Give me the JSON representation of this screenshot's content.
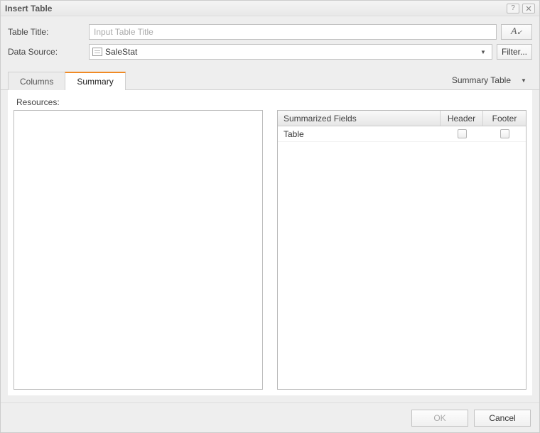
{
  "window": {
    "title": "Insert Table"
  },
  "form": {
    "title_label": "Table Title:",
    "title_placeholder": "Input Table Title",
    "title_value": "",
    "font_button_tooltip": "Font",
    "datasource_label": "Data Source:",
    "datasource_value": "SaleStat",
    "filter_button": "Filter..."
  },
  "tabs": {
    "items": [
      {
        "label": "Columns",
        "active": false
      },
      {
        "label": "Summary",
        "active": true
      }
    ],
    "view_selector": "Summary Table"
  },
  "summary": {
    "resources_label": "Resources:",
    "table": {
      "columns": [
        {
          "label": "Summarized Fields"
        },
        {
          "label": "Header"
        },
        {
          "label": "Footer"
        }
      ],
      "rows": [
        {
          "name": "Table",
          "header": false,
          "footer": false
        }
      ]
    }
  },
  "footer": {
    "ok": "OK",
    "cancel": "Cancel"
  }
}
